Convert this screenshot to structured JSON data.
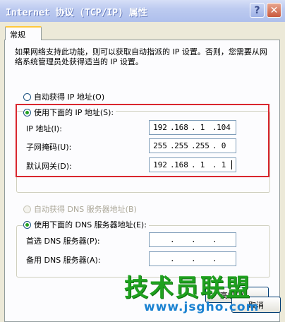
{
  "window": {
    "title": "Internet 协议 (TCP/IP) 属性",
    "help_glyph": "?",
    "close_glyph": "✕"
  },
  "tab": {
    "label": "常规"
  },
  "description": "如果网络支持此功能，则可以获取自动指派的 IP 设置。否则，您需要从网络系统管理员处获得适当的 IP 设置。",
  "ip_mode": {
    "auto_label": "自动获得 IP 地址(O)",
    "manual_label": "使用下面的 IP 地址(S):",
    "selected": "manual"
  },
  "ip_fields": [
    {
      "label": "IP 地址(I):",
      "octets": [
        "192",
        "168",
        "1",
        "104"
      ]
    },
    {
      "label": "子网掩码(U):",
      "octets": [
        "255",
        "255",
        "255",
        "0"
      ]
    },
    {
      "label": "默认网关(D):",
      "octets": [
        "192",
        "168",
        "1",
        "1"
      ]
    }
  ],
  "dns_mode": {
    "auto_label": "自动获得 DNS 服务器地址(B)",
    "manual_label": "使用下面的 DNS 服务器地址(E):",
    "auto_enabled": false,
    "selected": "manual"
  },
  "dns_fields": [
    {
      "label": "首选 DNS 服务器(P):",
      "octets": [
        "",
        "",
        "",
        ""
      ]
    },
    {
      "label": "备用 DNS 服务器(A):",
      "octets": [
        "",
        "",
        "",
        ""
      ]
    }
  ],
  "buttons": {
    "advanced": "高级(V)...",
    "cancel": "取消"
  },
  "watermark": {
    "main": "技术员联盟",
    "sub": "www.jsgho.com"
  },
  "colors": {
    "highlight_border": "#d9262e",
    "watermark_green": "#1fa11f",
    "watermark_blue": "#1b82d1"
  }
}
